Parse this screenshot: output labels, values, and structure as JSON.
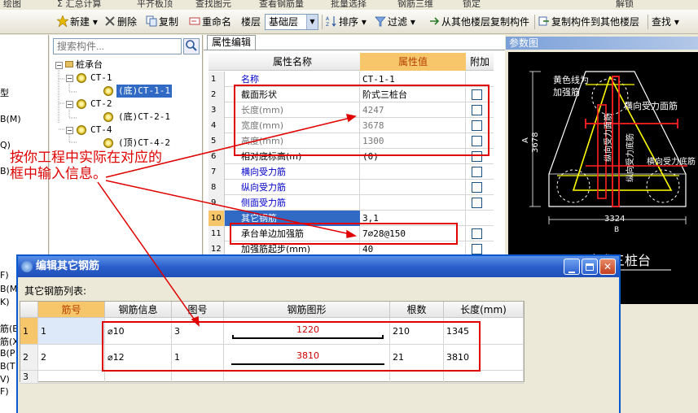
{
  "menubar": {
    "items": [
      "绘图",
      "Σ 汇总计算",
      "平齐板顶",
      "查找图元",
      "查看钢筋量",
      "批量选择",
      "钢筋三维",
      "锁定",
      "解锁"
    ]
  },
  "toolbar": {
    "new_label": "新建",
    "delete_label": "删除",
    "copy_label": "复制",
    "rename_label": "重命名",
    "floor_label": "楼层",
    "floor_value": "基础层",
    "sort_label": "排序",
    "filter_label": "过滤",
    "copy_from_label": "从其他楼层复制构件",
    "copy_to_label": "复制构件到其他楼层",
    "find_label": "查找"
  },
  "leftstrip": {
    "labels": [
      "型",
      "B(M)",
      "Q)",
      "B)",
      "F)",
      "B(M",
      "K)",
      "筋(B",
      "筋(X",
      "B(P",
      "B(T",
      "V)",
      "F)"
    ]
  },
  "tree": {
    "search_placeholder": "搜索构件...",
    "root": "桩承台",
    "groups": [
      {
        "name": "CT-1",
        "child": "(底)CT-1-1"
      },
      {
        "name": "CT-2",
        "child": "(底)CT-2-1"
      },
      {
        "name": "CT-4",
        "child": "(顶)CT-4-2"
      }
    ]
  },
  "property_tab": "属性编辑",
  "property_grid": {
    "headers": [
      "属性名称",
      "属性值",
      "附加"
    ],
    "rows": [
      {
        "n": "1",
        "name": "名称",
        "value": "CT-1-1",
        "style": "blue",
        "check": false
      },
      {
        "n": "2",
        "name": "截面形状",
        "value": "阶式三桩台",
        "style": "normal",
        "check": true
      },
      {
        "n": "3",
        "name": "长度(mm)",
        "value": "4247",
        "style": "gray",
        "check": true
      },
      {
        "n": "4",
        "name": "宽度(mm)",
        "value": "3678",
        "style": "gray",
        "check": true
      },
      {
        "n": "5",
        "name": "高度(mm)",
        "value": "1300",
        "style": "gray",
        "check": true
      },
      {
        "n": "6",
        "name": "相对底标高(m)",
        "value": "(0)",
        "style": "normal",
        "check": true
      },
      {
        "n": "7",
        "name": "横向受力筋",
        "value": "",
        "style": "blue",
        "check": true
      },
      {
        "n": "8",
        "name": "纵向受力筋",
        "value": "",
        "style": "blue",
        "check": true
      },
      {
        "n": "9",
        "name": "侧面受力筋",
        "value": "",
        "style": "blue",
        "check": true
      },
      {
        "n": "10",
        "name": "其它钢筋",
        "value": "3,1",
        "style": "selected",
        "check": false
      },
      {
        "n": "11",
        "name": "承台单边加强筋",
        "value": "7⌀28@150",
        "style": "normal",
        "check": true
      },
      {
        "n": "12",
        "name": "加强筋起步(mm)",
        "value": "40",
        "style": "normal",
        "check": true
      }
    ]
  },
  "reference": {
    "title": "参数图",
    "caption": "阶式三桩台",
    "yellow_note": "黄色线为加强筋",
    "label_h_top": "横向受力面筋",
    "label_v_top": "纵向受力面筋",
    "label_v_bottom": "纵向受力底筋",
    "label_h_bottom": "横向受力底筋",
    "dim_a": "A",
    "dim_a_value": "3678",
    "dim_b": "B",
    "dim_b_value": "3324"
  },
  "annotation": {
    "line1": "按你工程中实际在对应的",
    "line2": "框中输入信息。"
  },
  "dialog": {
    "title": "编辑其它钢筋",
    "list_label": "其它钢筋列表:",
    "headers": [
      "筋号",
      "钢筋信息",
      "图号",
      "钢筋图形",
      "根数",
      "长度(mm)"
    ],
    "rows": [
      {
        "n": "1",
        "bar_no": "1",
        "info": "⌀10",
        "fig": "3",
        "shape_len": "1220",
        "count": "210",
        "length": "1345"
      },
      {
        "n": "2",
        "bar_no": "2",
        "info": "⌀12",
        "fig": "1",
        "shape_len": "3810",
        "count": "21",
        "length": "3810"
      },
      {
        "n": "3",
        "bar_no": "",
        "info": "",
        "fig": "",
        "shape_len": "",
        "count": "",
        "length": ""
      }
    ]
  },
  "colors": {
    "annotation_red": "#e00000",
    "title_blue": "#2c5fcc",
    "rebar_yellow": "#ffff00",
    "rebar_red": "#ff2020"
  }
}
